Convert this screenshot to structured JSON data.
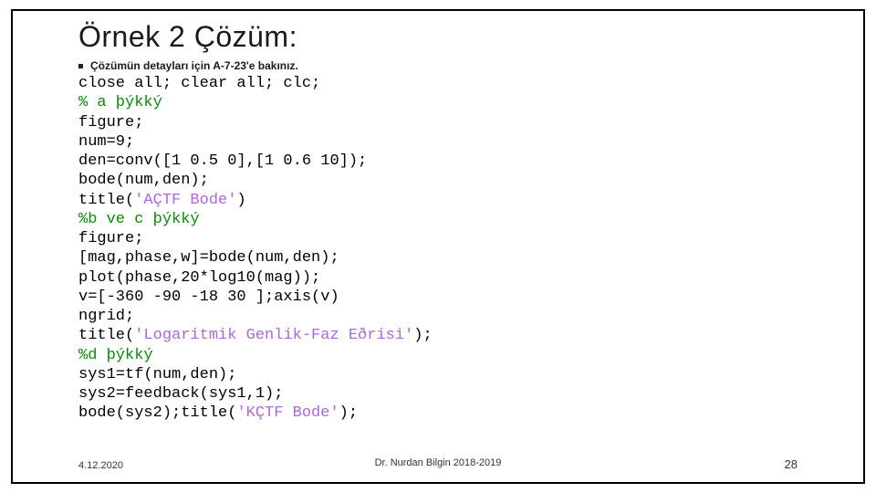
{
  "title": "Örnek 2 Çözüm:",
  "subtext": "Çözümün detayları için A-7-23'e bakınız.",
  "code": {
    "l1": "close all; clear all; clc;",
    "l2": "% a þýkký",
    "l3": "figure;",
    "l4": "num=9;",
    "l5": "den=conv([1 0.5 0],[1 0.6 10]);",
    "l6": "bode(num,den);",
    "l7a": "title(",
    "l7s": "'AÇTF Bode'",
    "l7b": ")",
    "l8": "%b ve c þýkký",
    "l9": "figure;",
    "l10": "[mag,phase,w]=bode(num,den);",
    "l11": "plot(phase,20*log10(mag));",
    "l12": "v=[-360 -90 -18 30 ];axis(v)",
    "l13": "ngrid;",
    "l14a": "title(",
    "l14s": "'Logaritmik Genlik-Faz Eðrisi'",
    "l14b": ");",
    "l15": "%d þýkký",
    "l16": "sys1=tf(num,den);",
    "l17": "sys2=feedback(sys1,1);",
    "l18a": "bode(sys2);title(",
    "l18s": "'KÇTF Bode'",
    "l18b": ");"
  },
  "footer": {
    "date": "4.12.2020",
    "author": "Dr. Nurdan Bilgin 2018-2019",
    "page": "28"
  }
}
